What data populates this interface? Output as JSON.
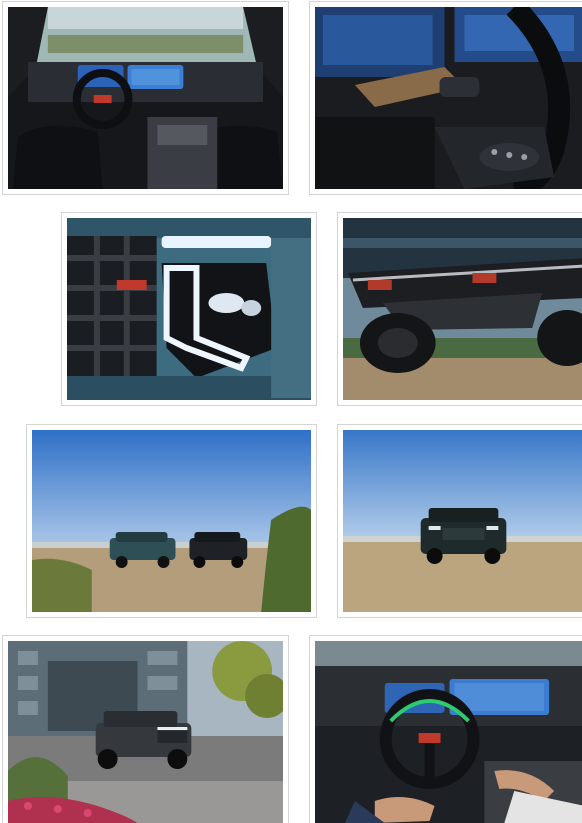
{
  "gallery": {
    "items": [
      {
        "subject": "interior-dashboard"
      },
      {
        "subject": "steering-wheel-closeup"
      },
      {
        "subject": "headlight-closeup"
      },
      {
        "subject": "rear-bumper-closeup"
      },
      {
        "subject": "two-suvs-beach"
      },
      {
        "subject": "suv-beach-front"
      },
      {
        "subject": "suv-city-street"
      },
      {
        "subject": "driver-hands-free"
      }
    ]
  },
  "colors": {
    "border": "#d4d4d4",
    "sky": "#3f7ccb",
    "sand": "#b9a27e",
    "teal_body": "#3d6b80",
    "dark_interior": "#1c1f24",
    "screen_blue": "#2a63b8"
  }
}
